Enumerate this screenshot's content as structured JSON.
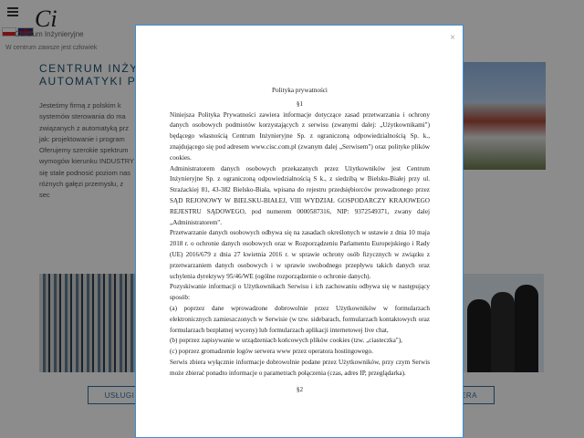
{
  "brand": {
    "name": "Centrum Inżynieryjne",
    "tagline": "W centrum zawsze jest człowiek",
    "logo_text": "Ci"
  },
  "hero": {
    "title_line1": "CENTRUM INŻYNI",
    "title_line2": "AUTOMATYKI PRZEI"
  },
  "intro_lines": [
    "Jesteśmy firmą z polskim k",
    "systemów sterowania do ma",
    "związanych z automatyką prz",
    "jak: projektowanie i program",
    "Oferujemy szerokie spektrum",
    "wymogów kierunku INDUSTRY",
    "się stale podnosić poziom nas",
    "różnych gałęzi przemysłu, z sec"
  ],
  "buttons": {
    "services": "USŁUGI",
    "career": "ERA"
  },
  "modal": {
    "close": "×",
    "title": "Polityka prywatności",
    "section1": "§1",
    "paragraphs": [
      "Niniejsza Polityka Prywatności zawiera informacje dotyczące zasad przetwarzania i ochrony danych osobowych podmiotów korzystających z serwisu (zwanymi dalej: „Użytkownikami\") będącego własnością Centrum Inżynieryjne Sp. z ograniczoną odpowiedzialnością Sp. k., znajdującego się pod adresem www.cisc.com.pl (zwanym dalej „Serwisem\") oraz polityke plików cookies.",
      "Administratorem danych osobowych przekazanych przez Użytkowników jest Centrum Inżynieryjne Sp. z ograniczoną odpowiedzialnością S k., z siedzibą w Bielsku-Białej przy ul. Strażackiej 81, 43-382 Bielsko-Biała, wpisana do rejestru przedsiębiorców prowadzonego przez SĄD REJONOWY W BIELSKU-BIAŁEJ, VIII WYDZIAŁ GOSPODARCZY KRAJOWEGO REJESTRU SĄDOWEGO, pod numerem 0000587316, NIP: 9372549371, zwany dalej „Administratorem\".",
      "Przetwarzanie danych osobowych odbywa się na zasadach określonych w ustawie z dnia 10 maja 2018 r. o ochronie danych osobowych oraz w Rozporządzeniu Parlamentu Europejskiego i Rady (UE) 2016/679 z dnia 27 kwietnia 2016 r. w sprawie ochrony osób fizycznych w związku z przetwarzaniem danych osobowych i w sprawie swobodnego przepływu takich danych oraz uchylenia dyrektywy 95/46/WE (ogólne rozporządzenie o ochronie danych).",
      "Pozyskiwanie informacji o Użytkownikach Serwisu i ich zachowaniu odbywa się w następujący sposób:",
      "(a) poprzez dane wprowadzone dobrowolnie przez Użytkowników w formularzach elektronicznych zamieszczonych w Serwisie (w tzw. sidebarach, formularzach kontaktowych oraz formularzach bezpłatnej wyceny) lub formularzach aplikacji internetowej live chat,",
      "(b) poprzez zapisywanie w urządzeniach końcowych plików cookies (tzw. „ciasteczka\"),",
      "(c) poprzez gromadzenie logów serwera www przez operatora hostingowego.",
      "Serwis zbiera wyłącznie informacje dobrowolnie podane przez Użytkowników, przy czym Serwis może zbierać ponadto informacje o parametrach połączenia (czas, adres IP, przeglądarka)."
    ],
    "section2": "§2"
  }
}
